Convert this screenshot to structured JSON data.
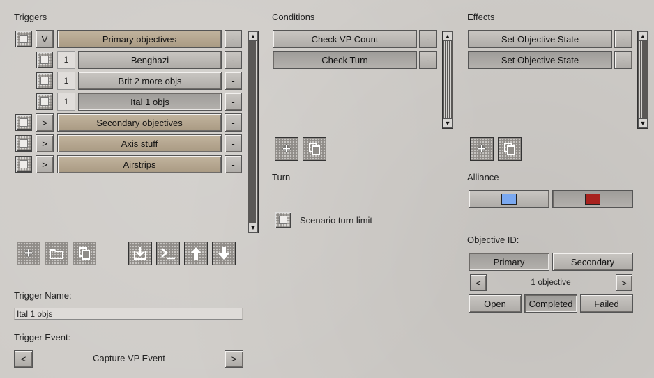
{
  "triggers": {
    "header": "Triggers",
    "rows": [
      {
        "toggle": "V",
        "label": "Primary objectives",
        "minus": "-"
      },
      {
        "num": "1",
        "label": "Benghazi",
        "minus": "-"
      },
      {
        "num": "1",
        "label": "Brit 2 more objs",
        "minus": "-"
      },
      {
        "num": "1",
        "label": "Ital 1 objs",
        "minus": "-"
      },
      {
        "toggle": ">",
        "label": "Secondary objectives",
        "minus": "-"
      },
      {
        "toggle": ">",
        "label": "Axis stuff",
        "minus": "-"
      },
      {
        "toggle": ">",
        "label": "Airstrips",
        "minus": "-"
      }
    ],
    "toolbar_icons": [
      "add-icon",
      "folder-icon",
      "copy-icon",
      "import-icon",
      "console-icon",
      "move-up-icon",
      "move-down-icon"
    ],
    "trigger_name_label": "Trigger Name:",
    "trigger_name_value": "Ital 1 objs",
    "trigger_event_label": "Trigger Event:",
    "trigger_event_value": "Capture VP Event",
    "prev": "<",
    "next": ">"
  },
  "conditions": {
    "header": "Conditions",
    "rows": [
      {
        "label": "Check VP Count",
        "minus": "-"
      },
      {
        "label": "Check Turn",
        "minus": "-"
      }
    ],
    "turn_label": "Turn",
    "turn_limit_label": "Scenario turn limit"
  },
  "effects": {
    "header": "Effects",
    "rows": [
      {
        "label": "Set Objective State",
        "minus": "-"
      },
      {
        "label": "Set Objective State",
        "minus": "-"
      }
    ],
    "alliance_label": "Alliance",
    "alliance_colors": [
      "#7aa8f0",
      "#a8221e"
    ],
    "objective_id_label": "Objective ID:",
    "primary_label": "Primary",
    "secondary_label": "Secondary",
    "objective_value": "1 objective",
    "prev": "<",
    "next": ">",
    "open_label": "Open",
    "completed_label": "Completed",
    "failed_label": "Failed"
  },
  "scroll": {
    "up": "▲",
    "down": "▼"
  }
}
